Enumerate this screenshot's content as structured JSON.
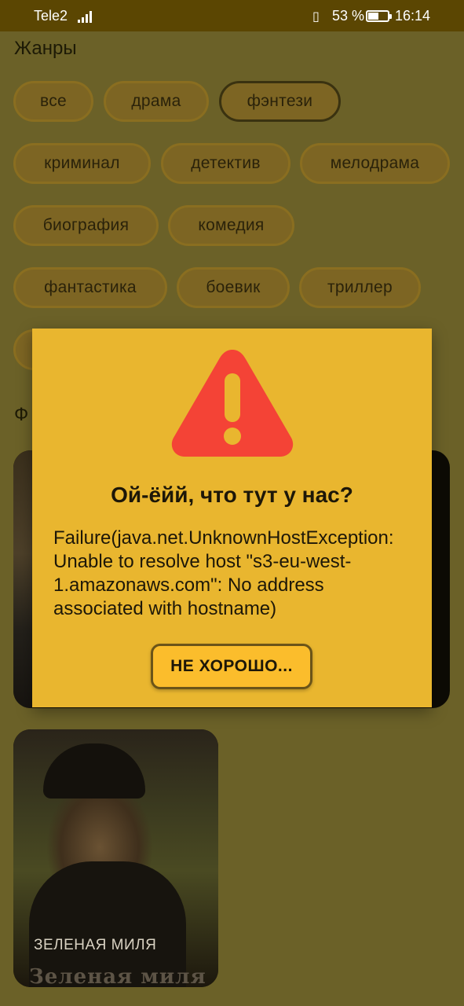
{
  "status_bar": {
    "carrier": "Tele2",
    "battery_percent": "53 %",
    "time": "16:14",
    "icons": [
      "signal-icon",
      "vibrate-icon",
      "battery-icon"
    ]
  },
  "genres": {
    "title": "Жанры",
    "chips": [
      "все",
      "драма",
      "фэнтези",
      "криминал",
      "детектив",
      "мелодрама",
      "биография",
      "комедия",
      "фантастика",
      "боевик",
      "триллер",
      ""
    ],
    "selected": "фэнтези"
  },
  "films": {
    "title_partial": "Ф",
    "cards": [
      {
        "title": ""
      },
      {
        "title": "ЗЕЛЕНАЯ МИЛЯ",
        "poster_text": "Зеленая миля"
      }
    ]
  },
  "dialog": {
    "icon": "warning-icon",
    "title": "Ой-ёйй, что тут у нас?",
    "message": "Failure(java.net.UnknownHostException: Unable to resolve host \"s3-eu-west-1.amazonaws.com\": No address associated with hostname)",
    "button_label": "НЕ ХОРОШО..."
  },
  "colors": {
    "dialog_bg": "#e9b62f",
    "button_bg": "#fbbd2c",
    "warning_red": "#f44336",
    "scrim": "#6b6128"
  }
}
